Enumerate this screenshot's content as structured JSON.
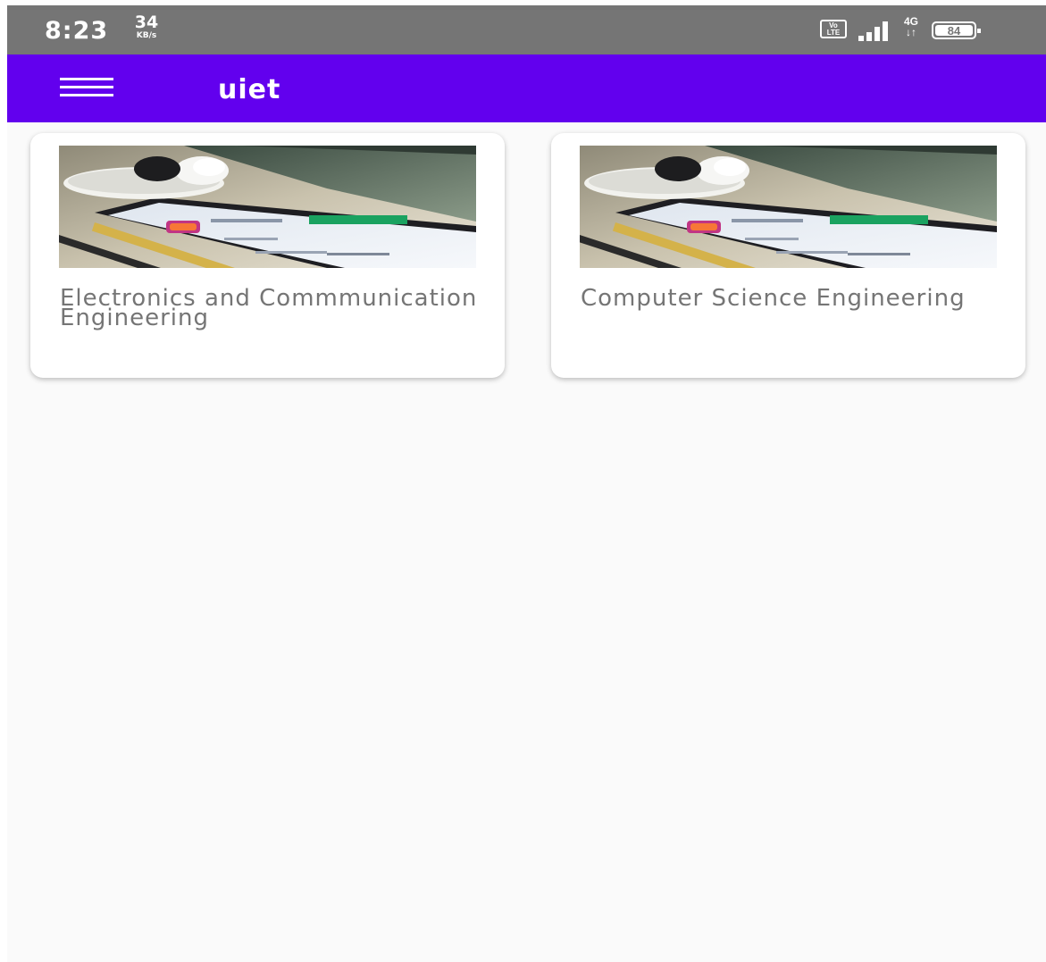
{
  "status_bar": {
    "time": "8:23",
    "net_speed_value": "34",
    "net_speed_unit": "KB/s",
    "volte_top": "Vo",
    "volte_bottom": "LTE",
    "network_type": "4G",
    "battery_level": "84"
  },
  "app_bar": {
    "title": "uiet",
    "menu_icon": "hamburger-menu-icon",
    "color": "#6200ee"
  },
  "cards": [
    {
      "title": "Electronics and Commmunication Engineering",
      "image": "phone-on-desk-photo"
    },
    {
      "title": "Computer Science Engineering",
      "image": "phone-on-desk-photo"
    }
  ],
  "colors": {
    "status_bar": "#757575",
    "background": "#fafafa",
    "card_text": "#757575"
  }
}
